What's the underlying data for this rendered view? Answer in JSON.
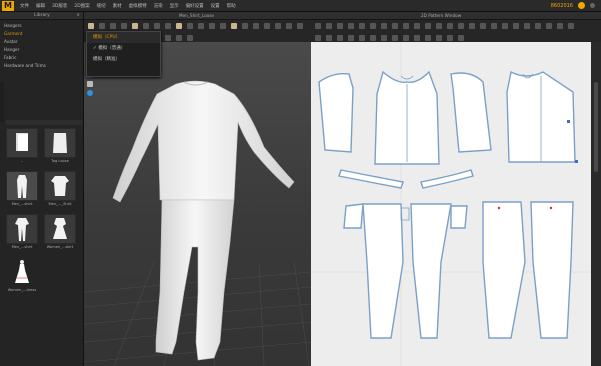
{
  "menubar": {
    "logo": "M",
    "items": [
      "文件",
      "编辑",
      "3D服装",
      "2D图案",
      "缝纫",
      "素材",
      "虚拟模特",
      "渲染",
      "显示",
      "偏好设置",
      "设置",
      "帮助"
    ],
    "user_id": "8602016"
  },
  "library": {
    "title": "Library",
    "items": [
      "Hangers",
      "Garment",
      "Avatar",
      "Hanger",
      "Fabric",
      "Hardware and Trims"
    ],
    "active_index": 1,
    "thumbnails": [
      "..",
      "Tag Loose",
      "Men_...shirt",
      "Men_..._Shirt",
      "Men_...shirt",
      "Women_...skirt",
      "Women_...dress"
    ]
  },
  "window3d": {
    "title": "Men_Shirt_Loose"
  },
  "window2d": {
    "title": "2D Pattern Window"
  },
  "dropdown": {
    "items": [
      "模拟（CPU）",
      "模拟（普通）",
      "模拟（精准）"
    ],
    "highlight_index": 0,
    "checked_index": 1
  },
  "colors": {
    "accent": "#f0a800",
    "pattern_fill": "#ffffff",
    "pattern_outline": "#7ba0c8",
    "viewport2d_bg": "#ededed"
  }
}
